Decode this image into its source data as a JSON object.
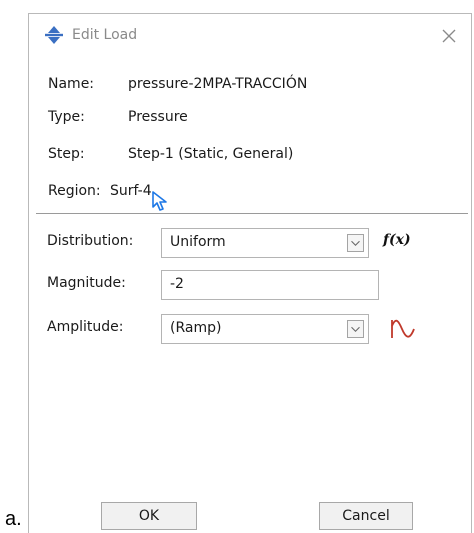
{
  "outer_label": "a.",
  "dialog": {
    "title": "Edit Load",
    "icons": {
      "app": "move-arrows-icon",
      "close": "close-icon"
    }
  },
  "info": {
    "name_label": "Name:",
    "name_value": "pressure-2MPA-TRACCIÓN",
    "type_label": "Type:",
    "type_value": "Pressure",
    "step_label": "Step:",
    "step_value": "Step-1 (Static, General)",
    "region_label": "Region:",
    "region_value": "Surf-4",
    "region_icon": "select-cursor-icon"
  },
  "fields": {
    "distribution_label": "Distribution:",
    "distribution_value": "Uniform",
    "fx_label": "f(x)",
    "magnitude_label": "Magnitude:",
    "magnitude_value": "-2",
    "amplitude_label": "Amplitude:",
    "amplitude_value": "(Ramp)",
    "amplitude_icon": "amplitude-curve-icon"
  },
  "buttons": {
    "ok": "OK",
    "cancel": "Cancel"
  },
  "colors": {
    "accent": "#1e78e6",
    "amplitude_icon": "#c0392b",
    "separator": "#9a9a9a"
  }
}
